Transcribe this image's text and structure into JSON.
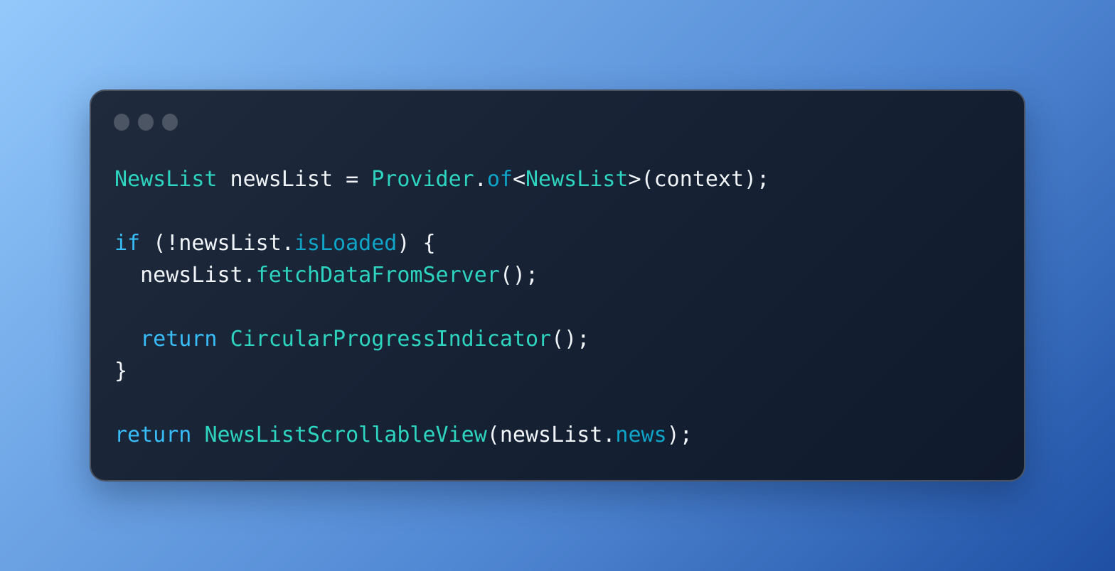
{
  "window": {
    "controls": [
      "window-dot-1",
      "window-dot-2",
      "window-dot-3"
    ]
  },
  "colors": {
    "default": "#f1f5f9",
    "type": "#2dd4bf",
    "method": "#2dd4bf",
    "property": "#0ea5c9",
    "keyword": "#38bdf8",
    "dot": "#4b5563"
  },
  "code": {
    "lines": [
      [
        {
          "t": "NewsList",
          "c": "type"
        },
        {
          "t": " newsList = ",
          "c": "default"
        },
        {
          "t": "Provider",
          "c": "type"
        },
        {
          "t": ".",
          "c": "default"
        },
        {
          "t": "of",
          "c": "property"
        },
        {
          "t": "<",
          "c": "default"
        },
        {
          "t": "NewsList",
          "c": "type"
        },
        {
          "t": ">(context);",
          "c": "default"
        }
      ],
      [],
      [
        {
          "t": "if",
          "c": "keyword"
        },
        {
          "t": " (!newsList.",
          "c": "default"
        },
        {
          "t": "isLoaded",
          "c": "property"
        },
        {
          "t": ") {",
          "c": "default"
        }
      ],
      [
        {
          "t": "  newsList.",
          "c": "default"
        },
        {
          "t": "fetchDataFromServer",
          "c": "method"
        },
        {
          "t": "();",
          "c": "default"
        }
      ],
      [],
      [
        {
          "t": "  ",
          "c": "default"
        },
        {
          "t": "return",
          "c": "keyword"
        },
        {
          "t": " ",
          "c": "default"
        },
        {
          "t": "CircularProgressIndicator",
          "c": "type"
        },
        {
          "t": "();",
          "c": "default"
        }
      ],
      [
        {
          "t": "}",
          "c": "default"
        }
      ],
      [],
      [
        {
          "t": "return",
          "c": "keyword"
        },
        {
          "t": " ",
          "c": "default"
        },
        {
          "t": "NewsListScrollableView",
          "c": "type"
        },
        {
          "t": "(newsList.",
          "c": "default"
        },
        {
          "t": "news",
          "c": "property"
        },
        {
          "t": ");",
          "c": "default"
        }
      ]
    ]
  }
}
